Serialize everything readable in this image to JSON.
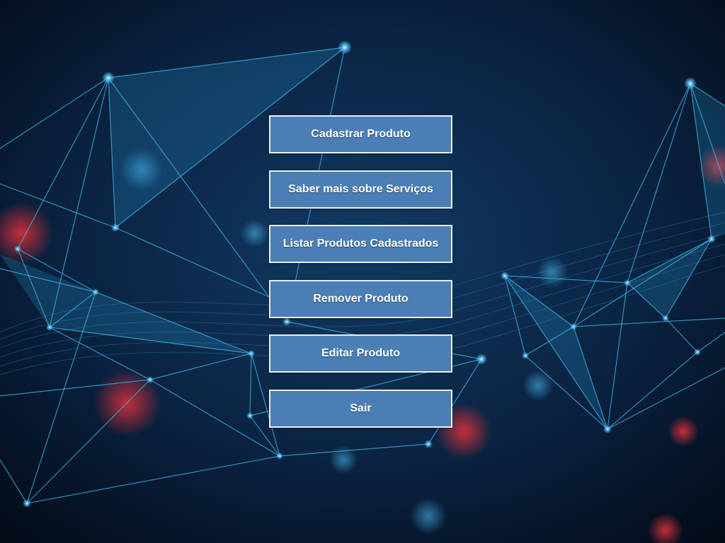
{
  "menu": {
    "items": [
      {
        "label": "Cadastrar Produto"
      },
      {
        "label": "Saber mais sobre Serviços"
      },
      {
        "label": "Listar Produtos Cadastrados"
      },
      {
        "label": "Remover Produto"
      },
      {
        "label": "Editar Produto"
      },
      {
        "label": "Sair"
      }
    ]
  },
  "colors": {
    "background": "#061426",
    "button": "#4a7eb5",
    "button_border": "#e8eef6",
    "button_text": "#ffffff",
    "network_line": "#3fb4e8"
  }
}
